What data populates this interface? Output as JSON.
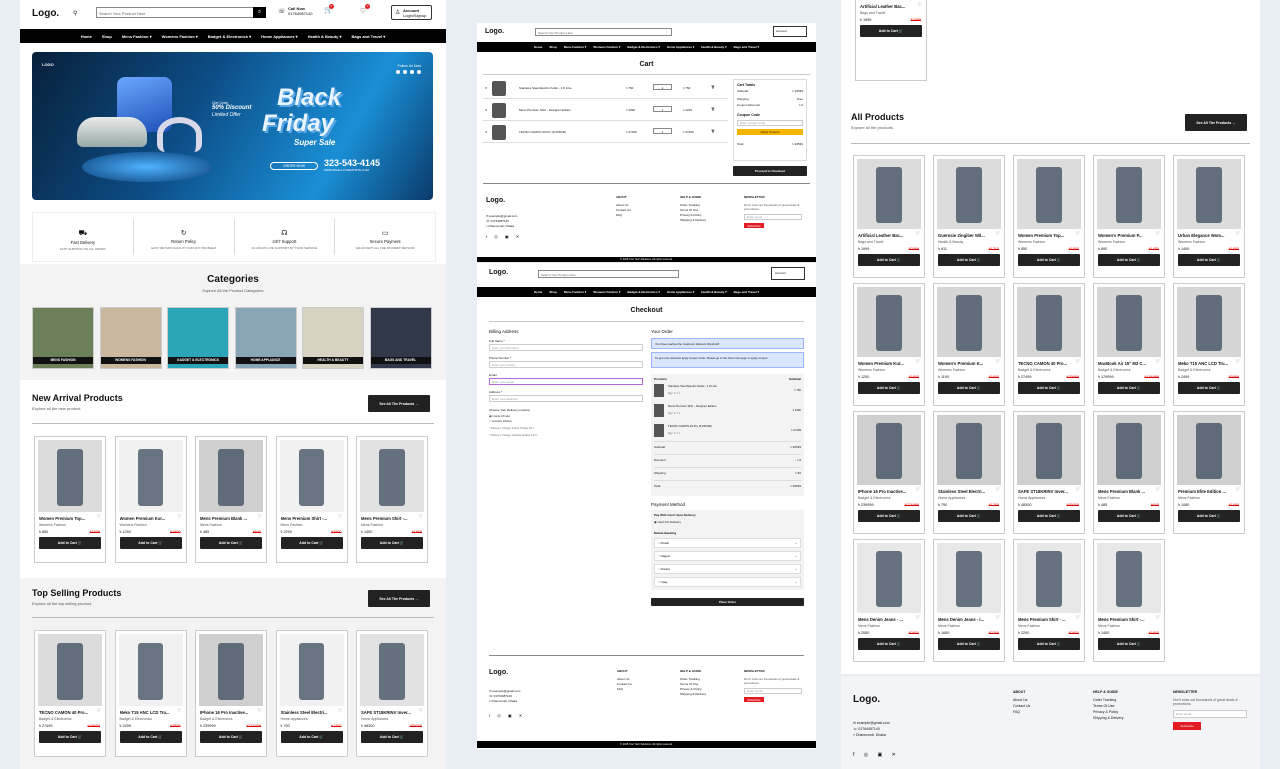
{
  "brand": {
    "logo": "Logo."
  },
  "header": {
    "search_placeholder": "Search Your Product Here",
    "call_label": "Call Now",
    "call_number": "01764087140",
    "cart_count": "0",
    "wish_count": "0",
    "account_label": "Account",
    "account_sub": "Login/Signup"
  },
  "nav": [
    "Home",
    "Shop",
    "Mens Fashion ▾",
    "Womens Fashion ▾",
    "Badget & Electronics ▾",
    "Home Appliances ▾",
    "Health & Beauty ▾",
    "Bags and Travel ▾"
  ],
  "hero": {
    "brand_mark": "LOGO",
    "follow": "Follow Us Now",
    "discount_line1": "Get Upto",
    "discount_line2": "50% Discount",
    "discount_line3": "Limited Offer",
    "word1": "Black",
    "word2": "Friday",
    "tagline": "Super Sale",
    "order_btn": "ORDER NOW",
    "phone": "323-543-4145",
    "website": "WWW.REALLYGREATSITE.COM"
  },
  "features": [
    {
      "icon": "truck-icon",
      "title": "Fast Delivery",
      "desc": "FAST SHIPPING ON ALL ORDER"
    },
    {
      "icon": "return-icon",
      "title": "Return Policy",
      "desc": "EASY RETURN FACILITY FOR ANY PROBLEM"
    },
    {
      "icon": "headset-icon",
      "title": "24/7 Support",
      "desc": "24 HOURS LIVE SUPPORT BY YOUR SERVICE"
    },
    {
      "icon": "card-icon",
      "title": "Secure Payment",
      "desc": "WE ACCEPT ALL THE PAYMENT METHOD"
    }
  ],
  "categories": {
    "title": "Categories",
    "subtitle": "Explore All the Product Categories",
    "items": [
      "MENS FASHION",
      "WOMENS FASHION",
      "GADGET & ELECTRONICS",
      "HOME APPLIANCE",
      "HEALTH & BEAUTY",
      "BAGS AND TRAVEL"
    ],
    "colors": [
      "#6b7f5a",
      "#c9b7a0",
      "#2aa6b8",
      "#8aa5b5",
      "#d8d2c3",
      "#30384a"
    ]
  },
  "new_arrival": {
    "title": "New Arrival Products",
    "subtitle": "Explore all the new product.",
    "see_all": "See All The Products →",
    "products": [
      {
        "name": "Women Premium Top...",
        "cat": "Womens Fashion",
        "price": "৳ 850",
        "old": "৳1500"
      },
      {
        "name": "Women Premium Kur...",
        "cat": "Womens Fashion",
        "price": "৳ 1250",
        "old": "৳1800"
      },
      {
        "name": "Mens Premium Blank ...",
        "cat": "Mens Fashion",
        "price": "৳ 485",
        "old": "৳640"
      },
      {
        "name": "Mens Premium Shirt -...",
        "cat": "Mens Fashion",
        "price": "৳ 2290",
        "old": "৳2800"
      },
      {
        "name": "Mens Premium Shirt -...",
        "cat": "Mens Fashion",
        "price": "৳ 1450",
        "old": "৳1800"
      }
    ]
  },
  "top_selling": {
    "title": "Top Selling Products",
    "subtitle": "Explore all the top selling product.",
    "see_all": "See All The Products →",
    "products": [
      {
        "name": "TECNO CAMON 40 Pro...",
        "cat": "Badget & Electronics",
        "price": "৳ 27499",
        "old": "৳29999"
      },
      {
        "name": "Meko T15 ANC LCD Tru...",
        "cat": "Badget & Electronics",
        "price": "৳ 2499",
        "old": "৳3999"
      },
      {
        "name": "IPhone 16 Pro Inactive...",
        "cat": "Badget & Electronics",
        "price": "৳ 239999",
        "old": "৳274999"
      },
      {
        "name": "Stainless Steel Electri...",
        "cat": "Home Appliances",
        "price": "৳ 750",
        "old": "৳1250"
      },
      {
        "name": "SAFE ST18KRINV Inver...",
        "cat": "Home Appliances",
        "price": "৳ 48300",
        "old": "৳55000"
      }
    ]
  },
  "add_to_cart": "Add to Cart 🛒",
  "cart": {
    "title": "Cart",
    "rows": [
      {
        "name": "Stainless Steel Electric Kettle - 1.8 Litre",
        "price": "৳ 750",
        "qty": "1",
        "total": "৳ 750"
      },
      {
        "name": "Mens Premium Shirt - Designer Edition",
        "price": "৳ 2290",
        "qty": "1",
        "total": "৳ 2290"
      },
      {
        "name": "TECNO CAMON 40 Pro (8 256GB)",
        "price": "৳ 27499",
        "qty": "1",
        "total": "৳ 27499"
      }
    ],
    "totals_title": "Cart Totals",
    "totals": [
      {
        "k": "Subtotal",
        "v": "৳ 30539"
      },
      {
        "k": "Shipping",
        "v": "Free"
      },
      {
        "k": "Coupon Discount",
        "v": "৳ 0"
      }
    ],
    "coupon_title": "Coupon Code",
    "coupon_placeholder": "Enter coupon code",
    "apply_btn": "Apply Coupon",
    "total_label": "Total",
    "total_value": "৳ 30539",
    "checkout_btn": "Proceed to Checkout"
  },
  "checkout": {
    "title": "Checkout",
    "billing_title": "Billing Address",
    "fields": [
      {
        "label": "Full Name *",
        "placeholder": "Enter your full name"
      },
      {
        "label": "Phone Number *",
        "placeholder": "Enter your phone"
      },
      {
        "label": "Email",
        "placeholder": "Enter your email"
      },
      {
        "label": "Address *",
        "placeholder": "Enter your address"
      }
    ],
    "location_title": "Choose Your Delivery Location",
    "locations": [
      "Inside Dhaka",
      "Outside Dhaka"
    ],
    "notes": [
      "* Delivery Charge Inside Dhaka 60 ৳",
      "* Delivery Charge Outside Dhaka 120 ৳"
    ],
    "order_title": "Your Order",
    "alert1": "You have reached the maximum discount threshold!",
    "alert2": "To get more discount apply coupon code. Please go to the View Cart page to apply coupon.",
    "products_label": "Products",
    "subtotal_label": "Subtotal",
    "order_items": [
      {
        "name": "Stainless Steel Electric Kettle - 1.8 Litre",
        "qty": "Qty: 1 × ৳",
        "total": "৳ 750"
      },
      {
        "name": "Mens Premium Shirt - Designer Edition",
        "qty": "Qty: 1 × ৳",
        "total": "৳ 2290"
      },
      {
        "name": "TECNO CAMON 40 Pro (8 256GB)",
        "qty": "Qty: 1 × ৳",
        "total": "৳ 27499"
      }
    ],
    "summary": [
      {
        "k": "Subtotal",
        "v": "৳ 30539"
      },
      {
        "k": "Discount",
        "v": "- ৳ 0"
      },
      {
        "k": "Shipping",
        "v": "৳ 60"
      },
      {
        "k": "Total",
        "v": "৳ 30599"
      }
    ],
    "payment_title": "Payment Method",
    "pay_cod_title": "Pay With Cash Upon Delivery",
    "pay_cod": "Cash On Delivery",
    "mobile_title": "Mobile Banking",
    "mobile": [
      "bKash",
      "Nagad",
      "Rocket",
      "Upay"
    ],
    "place_order": "Place Order"
  },
  "right": {
    "top_card": {
      "name": "Artificial Leather Bac...",
      "cat": "Bags and Travel",
      "price": "৳ 1999",
      "old": "৳2999"
    },
    "all_title": "All Products",
    "all_subtitle": "Explore all the products.",
    "see_all": "See All The Products →",
    "products": [
      {
        "name": "Artificial Leather Bac...",
        "cat": "Bags and Travel",
        "price": "৳ 1999",
        "old": "৳2999"
      },
      {
        "name": "Guernsie Zingiber Wil...",
        "cat": "Health & Beauty",
        "price": "৳ 911",
        "old": "৳1210"
      },
      {
        "name": "Women Premium Top...",
        "cat": "Womens Fashion",
        "price": "৳ 850",
        "old": "৳1500"
      },
      {
        "name": "Women's Premium P...",
        "cat": "Womens Fashion",
        "price": "৳ 890",
        "old": "৳1450"
      },
      {
        "name": "Urban Elegance Wom...",
        "cat": "Womens Fashion",
        "price": "৳ 1490",
        "old": "৳1850"
      },
      {
        "name": "Women Premium Kur...",
        "cat": "Womens Fashion",
        "price": "৳ 1250",
        "old": "৳1800"
      },
      {
        "name": "Women's Premium K...",
        "cat": "Womens Fashion",
        "price": "৳ 1190",
        "old": "৳1600"
      },
      {
        "name": "TECNO CAMON 40 Pro...",
        "cat": "Badget & Electronics",
        "price": "৳ 27499",
        "old": "৳29999"
      },
      {
        "name": "MacBook Air 15\" M3 C...",
        "cat": "Badget & Electronics",
        "price": "৳ 179999",
        "old": "৳184999"
      },
      {
        "name": "Meko T15 ANC LCD Tru...",
        "cat": "Badget & Electronics",
        "price": "৳ 2499",
        "old": "৳3999"
      },
      {
        "name": "IPhone 16 Pro Inactive...",
        "cat": "Badget & Electronics",
        "price": "৳ 239999",
        "old": "৳274999"
      },
      {
        "name": "Stainless Steel Electri...",
        "cat": "Home Appliances",
        "price": "৳ 750",
        "old": "৳1250"
      },
      {
        "name": "SAFE ST18KRINV Inver...",
        "cat": "Home Appliances",
        "price": "৳ 48300",
        "old": "৳55000"
      },
      {
        "name": "Mens Premium Blank ...",
        "cat": "Mens Fashion",
        "price": "৳ 485",
        "old": "৳640"
      },
      {
        "name": "Premium Elite Edition ...",
        "cat": "Mens Fashion",
        "price": "৳ 1080",
        "old": "৳1490"
      },
      {
        "name": "Mens Denim Jeans - ...",
        "cat": "Mens Fashion",
        "price": "৳ 2050",
        "old": "৳2800"
      },
      {
        "name": "Mens Denim Jeans - l...",
        "cat": "Mens Fashion",
        "price": "৳ 1650",
        "old": "৳2200"
      },
      {
        "name": "Mens Premium Shirt - ...",
        "cat": "Mens Fashion",
        "price": "৳ 2290",
        "old": "৳2800"
      },
      {
        "name": "Mens Premium Shirt -...",
        "cat": "Mens Fashion",
        "price": "৳ 1450",
        "old": "৳1800"
      }
    ]
  },
  "footer": {
    "email": "✉ example@gmail.com",
    "phone": "☏ 01764087140",
    "address": "⌖ Dhanmondi, Dhaka",
    "about_title": "ABOUT",
    "about": [
      "About Us",
      "Contact Us",
      "FAQ"
    ],
    "help_title": "HELP & GUIDE",
    "help": [
      "Order Tracking",
      "Terms Of Use",
      "Privacy & Policy",
      "Shipping & Delivery"
    ],
    "news_title": "NEWSLETTER",
    "news_text": "Don't miss out thousands of great deals & promotions.",
    "news_placeholder": "Enter email",
    "subscribe": "Subscribe",
    "copyright": "© 2025 Your Tech Solutions. All rights reserved."
  },
  "colors": {
    "accent": "#e31b23",
    "dark": "#222222",
    "nav": "#000000",
    "coupon": "#f5b400"
  }
}
